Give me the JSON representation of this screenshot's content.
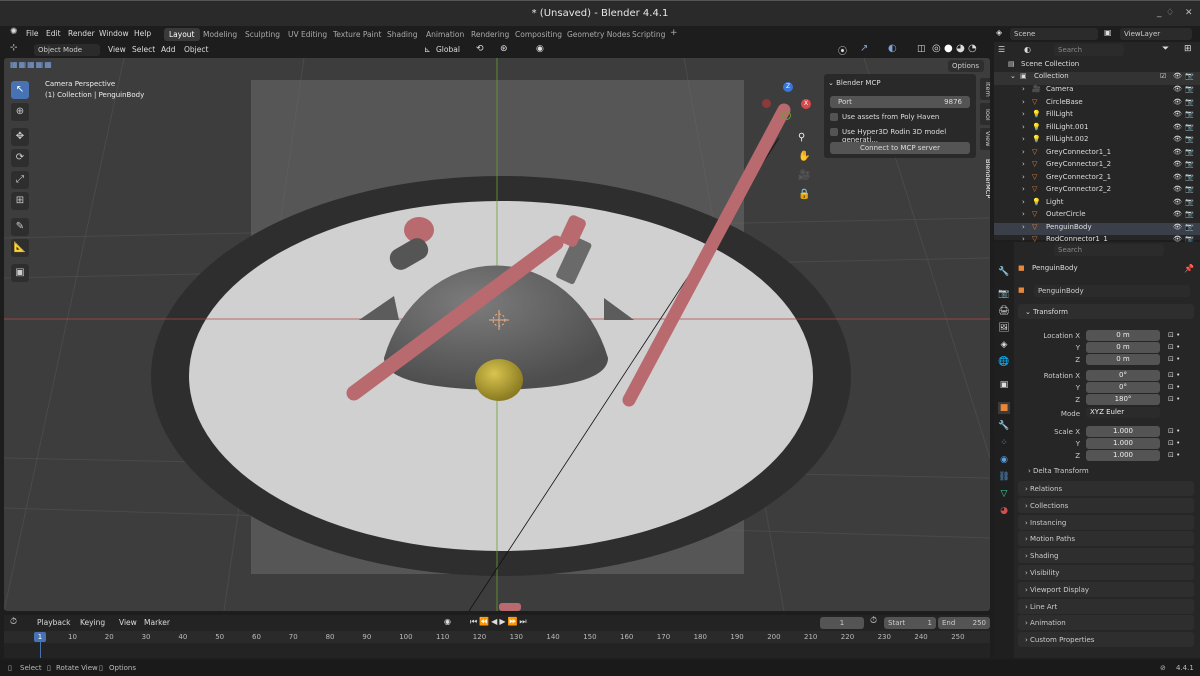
{
  "window": {
    "title": "* (Unsaved) - Blender 4.4.1",
    "minimize": "_",
    "maximize": "♢",
    "close": "✕"
  },
  "menu": {
    "items": [
      "File",
      "Edit",
      "Render",
      "Window",
      "Help"
    ]
  },
  "workspaces": [
    "Layout",
    "Modeling",
    "Sculpting",
    "UV Editing",
    "Texture Paint",
    "Shading",
    "Animation",
    "Rendering",
    "Compositing",
    "Geometry Nodes",
    "Scripting",
    "+"
  ],
  "active_workspace": "Layout",
  "scene": {
    "name": "Scene",
    "view_layer": "ViewLayer"
  },
  "header3d": {
    "mode": "Object Mode",
    "menus": [
      "View",
      "Select",
      "Add",
      "Object"
    ],
    "orientation": "Global",
    "options": "Options"
  },
  "viewport": {
    "camera_label": "Camera Perspective",
    "collection_label": "(1) Collection | PenguinBody",
    "gizmo": {
      "z": "Z",
      "x": "X"
    }
  },
  "side_tabs": [
    "Item",
    "Tool",
    "View",
    "BlenderMCP"
  ],
  "mcp_panel": {
    "title": "Blender MCP",
    "port_label": "Port",
    "port_value": "9876",
    "poly_haven": "Use assets from Poly Haven",
    "hyper3d": "Use Hyper3D Rodin 3D model generati...",
    "connect": "Connect to MCP server"
  },
  "timeline": {
    "menus": [
      "Playback",
      "Keying",
      "View",
      "Marker"
    ],
    "current_frame": "1",
    "start_label": "Start",
    "start": "1",
    "end_label": "End",
    "end": "250",
    "ticks": [
      "10",
      "20",
      "30",
      "40",
      "50",
      "60",
      "70",
      "80",
      "90",
      "100",
      "110",
      "120",
      "130",
      "140",
      "150",
      "160",
      "170",
      "180",
      "190",
      "200",
      "210",
      "220",
      "230",
      "240",
      "250"
    ],
    "cursor": "1"
  },
  "outliner": {
    "search_placeholder": "Search",
    "scene_collection": "Scene Collection",
    "collection": "Collection",
    "items": [
      {
        "name": "Camera",
        "type": "camera"
      },
      {
        "name": "CircleBase",
        "type": "mesh"
      },
      {
        "name": "FillLight",
        "type": "light"
      },
      {
        "name": "FillLight.001",
        "type": "light"
      },
      {
        "name": "FillLight.002",
        "type": "light"
      },
      {
        "name": "GreyConnector1_1",
        "type": "mesh"
      },
      {
        "name": "GreyConnector1_2",
        "type": "mesh"
      },
      {
        "name": "GreyConnector2_1",
        "type": "mesh"
      },
      {
        "name": "GreyConnector2_2",
        "type": "mesh"
      },
      {
        "name": "Light",
        "type": "light"
      },
      {
        "name": "OuterCircle",
        "type": "mesh"
      },
      {
        "name": "PenguinBody",
        "type": "mesh"
      },
      {
        "name": "RodConnector1_1",
        "type": "mesh"
      }
    ],
    "selected": "PenguinBody"
  },
  "properties": {
    "search_placeholder": "Search",
    "object_name": "PenguinBody",
    "datablock": "PenguinBody",
    "transform_title": "Transform",
    "location_label": "Location X",
    "location": [
      "0 m",
      "0 m",
      "0 m"
    ],
    "rotation_label": "Rotation X",
    "rotation": [
      "0°",
      "0°",
      "180°"
    ],
    "mode_label": "Mode",
    "mode": "XYZ Euler",
    "scale_label": "Scale X",
    "scale": [
      "1.000",
      "1.000",
      "1.000"
    ],
    "y_label": "Y",
    "z_label": "Z",
    "delta": "Delta Transform",
    "sections": [
      "Relations",
      "Collections",
      "Instancing",
      "Motion Paths",
      "Shading",
      "Visibility",
      "Viewport Display",
      "Line Art",
      "Animation",
      "Custom Properties"
    ]
  },
  "statusbar": {
    "select": "Select",
    "rotate": "Rotate View",
    "options": "Options",
    "version": "4.4.1"
  },
  "colors": {
    "accent": "#4772b3",
    "rod": "#b86a6e",
    "beak": "#b8a53a",
    "mesh_icon": "#e8873a",
    "data_icon": "#3fcfa0"
  }
}
